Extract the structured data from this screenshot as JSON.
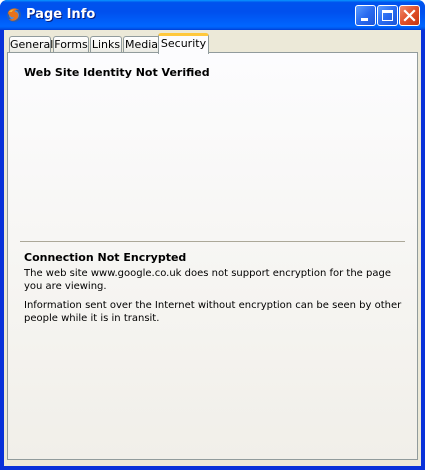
{
  "window": {
    "title": "Page Info",
    "icon": "firefox-icon",
    "controls": [
      "minimize-icon",
      "maximize-icon",
      "close-icon"
    ]
  },
  "tabs": [
    {
      "label": "General",
      "active": false
    },
    {
      "label": "Forms",
      "active": false
    },
    {
      "label": "Links",
      "active": false
    },
    {
      "label": "Media",
      "active": false
    },
    {
      "label": "Security",
      "active": true
    }
  ],
  "security": {
    "identity_heading": "Web Site Identity Not Verified",
    "connection_heading": "Connection Not Encrypted",
    "connection_text_1": "The web site www.google.co.uk does not support encryption for the page you are viewing.",
    "connection_text_2": "Information sent over the Internet without encryption can be seen by other people while it is in transit."
  },
  "colors": {
    "titlebar": "#0054e3",
    "close_button": "#e0502a",
    "active_tab_highlight": "#ffc83c",
    "dialog_face": "#ece9d8"
  }
}
